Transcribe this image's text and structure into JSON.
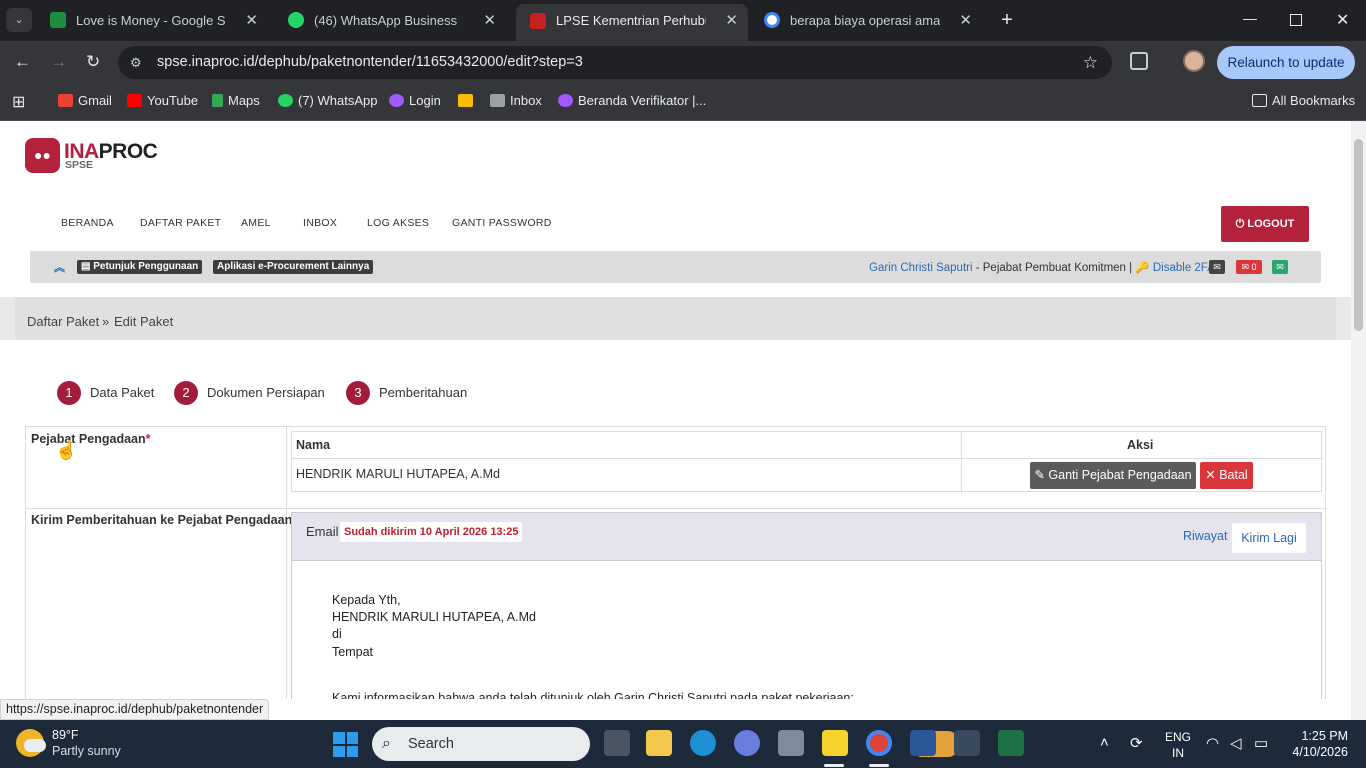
{
  "browser": {
    "tabs": [
      {
        "title": "Love is Money - Google Spread",
        "color": "#1e8e3e"
      },
      {
        "title": "(46) WhatsApp Business",
        "color": "#25d366"
      },
      {
        "title": "LPSE Kementrian Perhubungan",
        "color": "#c5221f"
      },
      {
        "title": "berapa biaya operasi amandel -",
        "color": "#4285f4"
      }
    ],
    "address": "spse.inaproc.id/dephub/paketnontender/11653432000/edit?step=3",
    "relaunch_label": "Relaunch to update",
    "bookmarks": [
      {
        "label": "Gmail",
        "color": "#ea4335"
      },
      {
        "label": "YouTube",
        "color": "#ff0000"
      },
      {
        "label": "Maps",
        "color": "#34a853"
      },
      {
        "label": "(7) WhatsApp",
        "color": "#25d366"
      },
      {
        "label": "Login",
        "color": "#a259ff"
      },
      {
        "label": "",
        "color": "#fbbc04"
      },
      {
        "label": "Inbox",
        "color": "#9aa0a6"
      },
      {
        "label": "Beranda Verifikator |...",
        "color": "#a259ff"
      }
    ],
    "all_bookmarks_label": "All Bookmarks",
    "status_url": "https://spse.inaproc.id/dephub/paketnontender"
  },
  "site": {
    "logo_a": "INA",
    "logo_b": "PROC",
    "logo_sub": "SPSE",
    "menu": [
      "BERANDA",
      "DAFTAR PAKET",
      "AMEL",
      "INBOX",
      "LOG AKSES",
      "GANTI PASSWORD"
    ],
    "logout_label": "LOGOUT",
    "help_pill": "Petunjuk Penggunaan",
    "apps_pill": "Aplikasi e-Procurement Lainnya",
    "user_name": "Garin Christi Saputri",
    "user_role": " - Pejabat Pembuat Komitmen | ",
    "twofa": "Disable 2FA",
    "mail_count": "0"
  },
  "breadcrumb": {
    "item1": "Daftar Paket",
    "sep": "»",
    "item2": "Edit Paket"
  },
  "steps": [
    {
      "num": "1",
      "label": "Data Paket"
    },
    {
      "num": "2",
      "label": "Dokumen Persiapan"
    },
    {
      "num": "3",
      "label": "Pemberitahuan"
    }
  ],
  "form": {
    "pejabat_label": "Pejabat Pengadaan",
    "required_mark": "*",
    "col_nama": "Nama",
    "col_aksi": "Aksi",
    "pejabat_name": "HENDRIK MARULI HUTAPEA, A.Md",
    "ganti_label": "Ganti Pejabat Pengadaan",
    "batal_label": "Batal",
    "kirim_label": "Kirim Pemberitahuan ke Pejabat Pengadaan",
    "email_label": "Email",
    "sent_badge": "Sudah dikirim 10 April 2026 13:25",
    "riwayat_label": "Riwayat",
    "kirim_lagi_label": "Kirim Lagi",
    "letter": [
      "Kepada Yth,",
      "HENDRIK MARULI HUTAPEA, A.Md",
      "di",
      "Tempat",
      "Kami informasikan bahwa anda telah ditunjuk oleh Garin Christi Saputri pada paket pekerjaan:"
    ]
  },
  "taskbar": {
    "temp": "89°F",
    "weather": "Partly sunny",
    "search_placeholder": "Search",
    "lang1": "ENG",
    "lang2": "IN",
    "time": "1:25 PM",
    "date": "4/10/2026"
  }
}
